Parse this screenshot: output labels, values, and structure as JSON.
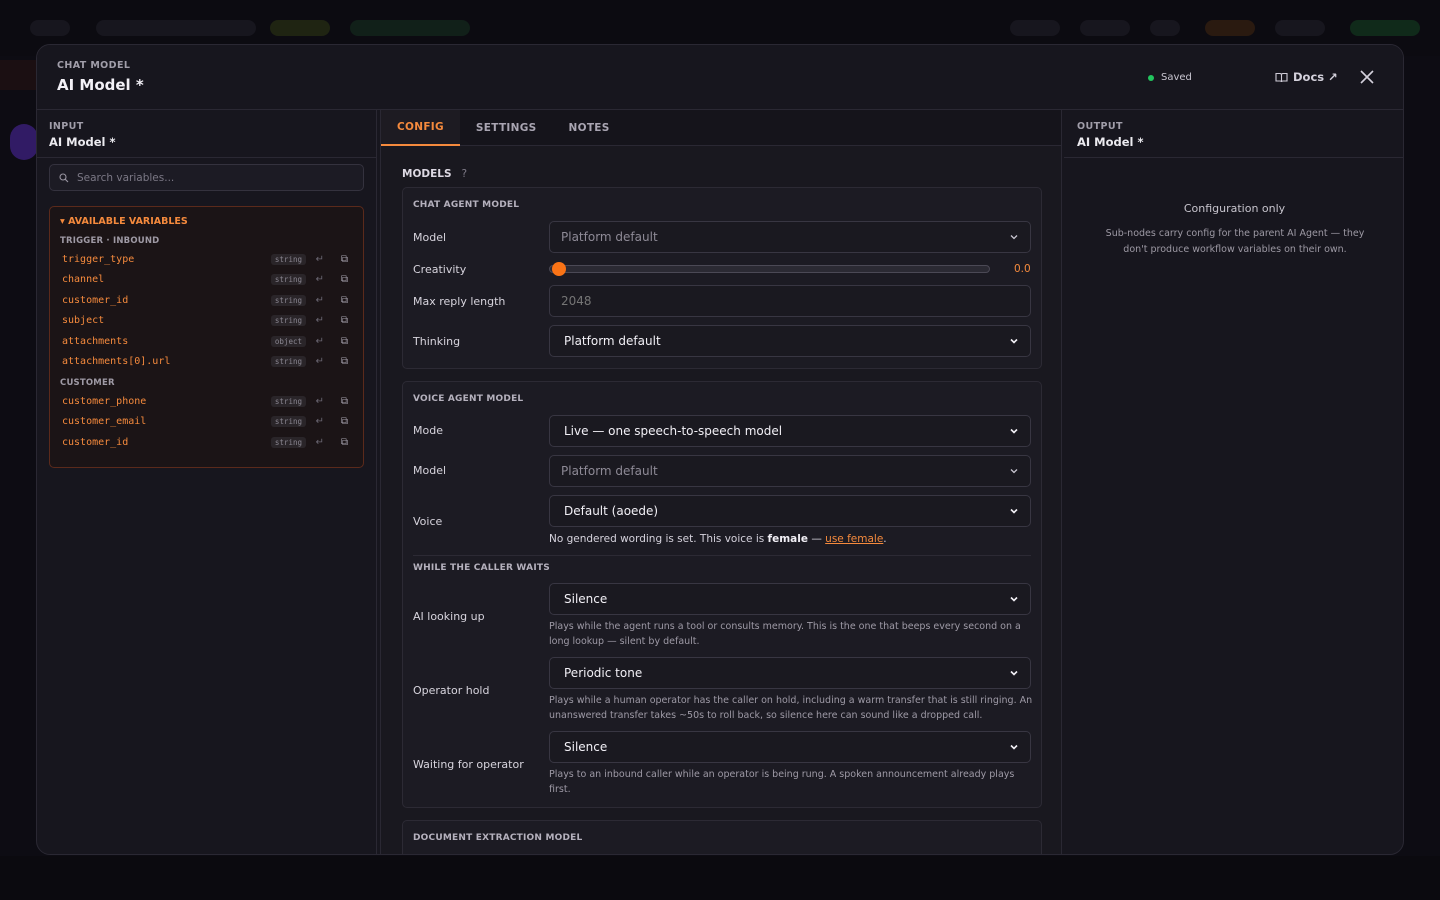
{
  "header": {
    "kicker": "CHAT MODEL",
    "title": "AI Model *",
    "saved": "Saved",
    "docs": "Docs ↗",
    "close_icon": "close-icon"
  },
  "input_panel": {
    "kicker": "INPUT",
    "title": "AI Model *",
    "search_placeholder": "Search variables...",
    "vars_title": "▾ AVAILABLE VARIABLES",
    "groups": [
      {
        "label": "TRIGGER · INBOUND",
        "items": [
          {
            "name": "trigger_type",
            "type": "string"
          },
          {
            "name": "channel",
            "type": "string"
          },
          {
            "name": "customer_id",
            "type": "string"
          },
          {
            "name": "subject",
            "type": "string"
          },
          {
            "name": "attachments",
            "type": "object"
          },
          {
            "name": "attachments[0].url",
            "type": "string"
          }
        ]
      },
      {
        "label": "CUSTOMER",
        "items": [
          {
            "name": "customer_phone",
            "type": "string"
          },
          {
            "name": "customer_email",
            "type": "string"
          },
          {
            "name": "customer_id",
            "type": "string"
          }
        ]
      }
    ]
  },
  "tabs": [
    "CONFIG",
    "SETTINGS",
    "NOTES"
  ],
  "config": {
    "section": "MODELS",
    "help_mark": "?",
    "chat_agent": {
      "title": "CHAT AGENT MODEL",
      "model_label": "Model",
      "model_value": "Platform default",
      "creativity_label": "Creativity",
      "creativity_value": "0.0",
      "creativity_level": 0.0,
      "max_reply_label": "Max reply length",
      "max_reply_placeholder": "2048",
      "thinking_label": "Thinking",
      "thinking_value": "Platform default"
    },
    "voice_agent": {
      "title": "VOICE AGENT MODEL",
      "mode_label": "Mode",
      "mode_value": "Live — one speech-to-speech model",
      "model_label": "Model",
      "model_value": "Platform default",
      "voice_label": "Voice",
      "voice_value": "Default (aoede)",
      "note_prefix": "No gendered wording is set. This voice is ",
      "note_bold": "female",
      "note_mid": " — ",
      "note_link": "use female",
      "note_suffix": "."
    },
    "waits": {
      "title": "WHILE THE CALLER WAITS",
      "lookup_label": "AI looking up",
      "lookup_value": "Silence",
      "lookup_help": "Plays while the agent runs a tool or consults memory. This is the one that beeps every second on a long lookup — silent by default.",
      "hold_label": "Operator hold",
      "hold_value": "Periodic tone",
      "hold_help": "Plays while a human operator has the caller on hold, including a warm transfer that is still ringing. An unanswered transfer takes ~50s to roll back, so silence here can sound like a dropped call.",
      "waiting_label": "Waiting for operator",
      "waiting_value": "Silence",
      "waiting_help": "Plays to an inbound caller while an operator is being rung. A spoken announcement already plays first."
    },
    "doc_extraction": {
      "title": "DOCUMENT EXTRACTION MODEL"
    }
  },
  "output_panel": {
    "kicker": "OUTPUT",
    "title": "AI Model *",
    "heading": "Configuration only",
    "description": "Sub-nodes carry config for the parent AI Agent — they don't produce workflow variables on their own."
  }
}
